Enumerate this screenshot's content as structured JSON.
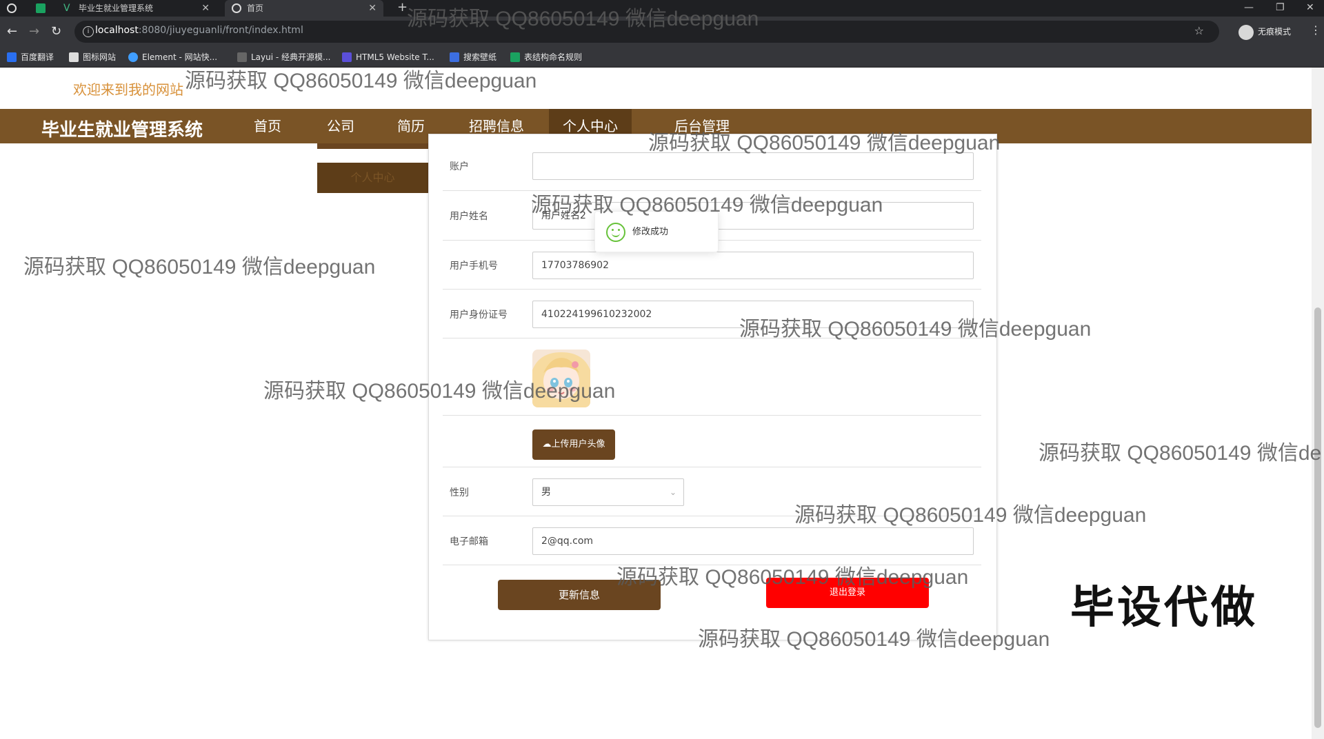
{
  "browser": {
    "tabs": [
      {
        "label": "毕业生就业管理系统",
        "active": false
      },
      {
        "label": "首页",
        "active": true
      }
    ],
    "new_tab": "+",
    "url_host": "localhost",
    "url_path": ":8080/jiuyeguanli/front/index.html",
    "profile_label": "无痕模式",
    "bookmarks": [
      "百度翻译",
      "图标网站",
      "Element - 网站快...",
      "Layui - 经典开源模...",
      "HTML5 Website T...",
      "搜索壁纸",
      "表结构命名规则"
    ]
  },
  "page": {
    "welcome": "欢迎来到我的网站",
    "brand": "毕业生就业管理系统",
    "nav": [
      "首页",
      "公司",
      "简历",
      "招聘信息",
      "个人中心",
      "后台管理"
    ],
    "nav_active_index": 4,
    "side_menu": "个人中心"
  },
  "form": {
    "account_label": "账户",
    "account_value": "",
    "name_label": "用户姓名",
    "name_value": "用户姓名2",
    "phone_label": "用户手机号",
    "phone_value": "17703786902",
    "id_label": "用户身份证号",
    "id_value": "410224199610232002",
    "upload_button": "上传用户头像",
    "gender_label": "性别",
    "gender_value": "男",
    "email_label": "电子邮箱",
    "email_value": "2@qq.com",
    "update_button": "更新信息",
    "logout_button": "退出登录"
  },
  "toast": {
    "message": "修改成功"
  },
  "watermarks": {
    "text": "源码获取 QQ86050149 微信deepguan",
    "partial": "源码获取 QQ86050149 微信de"
  },
  "promo": "毕设代做",
  "colors": {
    "brand_brown": "#7a5426",
    "welcome_orange": "#d8913a",
    "logout_red": "#ff0000",
    "success_green": "#67c23a"
  }
}
